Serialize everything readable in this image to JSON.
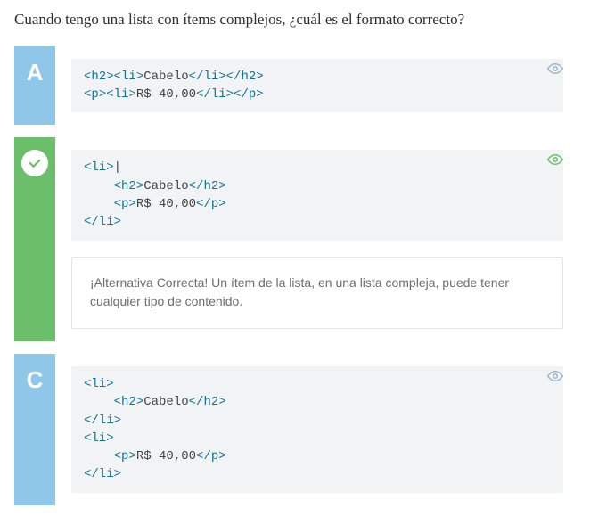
{
  "question": "Cuando tengo una lista con ítems complejos, ¿cuál es el formato correcto?",
  "options": {
    "a": {
      "label": "A",
      "code_html": "<span class=\"tag\">&lt;h2&gt;&lt;li&gt;</span>Cabelo<span class=\"tag\">&lt;/li&gt;&lt;/h2&gt;</span>\n<span class=\"tag\">&lt;p&gt;&lt;li&gt;</span>R$ 40,00<span class=\"tag\">&lt;/li&gt;&lt;/p&gt;</span>"
    },
    "b": {
      "code_html": "<span class=\"tag\">&lt;li&gt;</span>|\n    <span class=\"tag\">&lt;h2&gt;</span>Cabelo<span class=\"tag\">&lt;/h2&gt;</span>\n    <span class=\"tag\">&lt;p&gt;</span>R$ 40,00<span class=\"tag\">&lt;/p&gt;</span>\n<span class=\"tag\">&lt;/li&gt;</span>",
      "feedback": "¡Alternativa Correcta! Un ítem de la lista, en una lista compleja, puede tener cualquier tipo de contenido."
    },
    "c": {
      "label": "C",
      "code_html": "<span class=\"tag\">&lt;li&gt;</span>\n    <span class=\"tag\">&lt;h2&gt;</span>Cabelo<span class=\"tag\">&lt;/h2&gt;</span>\n<span class=\"tag\">&lt;/li&gt;</span>\n<span class=\"tag\">&lt;li&gt;</span>\n    <span class=\"tag\">&lt;p&gt;</span>R$ 40,00<span class=\"tag\">&lt;/p&gt;</span>\n<span class=\"tag\">&lt;/li&gt;</span>"
    }
  }
}
